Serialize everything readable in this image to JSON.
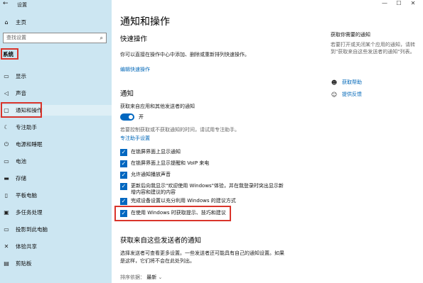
{
  "window": {
    "title": "设置",
    "controls": [
      "—",
      "☐",
      "✕"
    ]
  },
  "sidebar": {
    "home_label": "主页",
    "search_placeholder": "查找设置",
    "section_label": "系统",
    "items": [
      {
        "label": "显示",
        "icon": "display-icon"
      },
      {
        "label": "声音",
        "icon": "sound-icon"
      },
      {
        "label": "通知和操作",
        "icon": "notification-icon"
      },
      {
        "label": "专注助手",
        "icon": "focus-assist-icon"
      },
      {
        "label": "电源和睡眠",
        "icon": "power-icon"
      },
      {
        "label": "电池",
        "icon": "battery-icon"
      },
      {
        "label": "存储",
        "icon": "storage-icon"
      },
      {
        "label": "平板电脑",
        "icon": "tablet-icon"
      },
      {
        "label": "多任务处理",
        "icon": "multitasking-icon"
      },
      {
        "label": "投影到此电脑",
        "icon": "project-icon"
      },
      {
        "label": "体验共享",
        "icon": "shared-experiences-icon"
      },
      {
        "label": "剪贴板",
        "icon": "clipboard-icon"
      }
    ]
  },
  "main": {
    "title": "通知和操作",
    "quick_actions": {
      "heading": "快速操作",
      "desc": "你可以直接在操作中心中添加、删除或重新排列快速操作。",
      "edit_link": "编辑快速操作"
    },
    "notifications": {
      "heading": "通知",
      "toggle_desc": "获取来自应用和其他发送者的通知",
      "toggle_state": "开",
      "focus_desc": "若要控制获取或不获取通知的时间，请试用专注助手。",
      "focus_link": "专注助手设置",
      "checkboxes": [
        {
          "label": "在锁屏界面上显示通知",
          "checked": true
        },
        {
          "label": "在锁屏界面上显示提醒和 VoIP 来电",
          "checked": true
        },
        {
          "label": "允许通知播放声音",
          "checked": true
        },
        {
          "label": "更新后向我显示\"欢迎使用 Windows\"体验，并在我登录时突出显示新增内容和建议的内容",
          "checked": true
        },
        {
          "label": "完成设备设置以充分利用 Windows 的建议方式",
          "checked": true
        },
        {
          "label": "在使用 Windows 时获取提示、技巧和建议",
          "checked": true
        }
      ]
    },
    "senders": {
      "heading": "获取来自这些发送者的通知",
      "desc": "选择发送者可查看更多设置。一些发送者还可能具有自己的通知设置。如果是这样，它们将不会在此处列出。",
      "sort_label": "排序依据：",
      "sort_value": "最新"
    }
  },
  "right": {
    "title": "获取你需要的通知",
    "desc": "若要打开或关闭某个应用的通知，请转到\"获取来自这些发送者的通知\"列表。",
    "links": [
      {
        "label": "获取帮助",
        "icon": "help-icon"
      },
      {
        "label": "提供反馈",
        "icon": "feedback-icon"
      }
    ]
  }
}
